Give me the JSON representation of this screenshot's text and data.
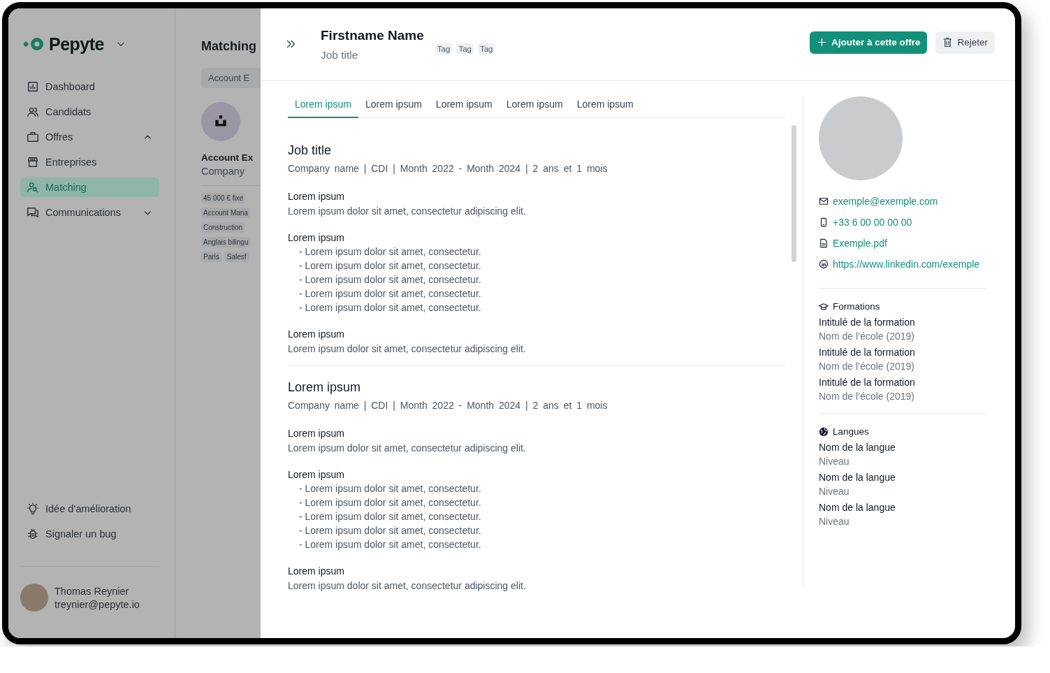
{
  "sidebar": {
    "logo": "Pepyte",
    "nav": [
      {
        "label": "Dashboard",
        "selected": false
      },
      {
        "label": "Candidats",
        "selected": false
      },
      {
        "label": "Offres",
        "selected": false,
        "expanded": true
      },
      {
        "label": "Entreprises",
        "selected": false
      },
      {
        "label": "Matching",
        "selected": true
      },
      {
        "label": "Communications",
        "selected": false,
        "expanded": false
      }
    ],
    "footer": [
      {
        "label": "Idée d’amélioration"
      },
      {
        "label": "Signaler un bug"
      }
    ],
    "user": {
      "name": "Thomas Reynier",
      "email": "treynier@pepyte.io"
    }
  },
  "list_panel": {
    "title": "Matching",
    "filter": "Account E",
    "offer": {
      "title": "Account Ex",
      "company": "Company",
      "tags": [
        [
          "45 000 € fixe"
        ],
        [
          "Account Mana"
        ],
        [
          "Construction"
        ],
        [
          "Anglais bilingu"
        ],
        [
          "Paris",
          "Salesf"
        ]
      ]
    }
  },
  "drawer": {
    "header": {
      "name": "Firstname Name",
      "job_title": "Job title",
      "tags": [
        "Tag",
        "Tag",
        "Tag"
      ],
      "primary_button": "Ajouter à cette offre",
      "secondary_button": "Rejeter"
    },
    "tabs": [
      {
        "label": "Lorem ipsum",
        "selected": true
      },
      {
        "label": "Lorem ipsum",
        "selected": false
      },
      {
        "label": "Lorem ipsum",
        "selected": false
      },
      {
        "label": "Lorem ipsum",
        "selected": false
      },
      {
        "label": "Lorem ipsum",
        "selected": false
      }
    ],
    "experiences": [
      {
        "title": "Job title",
        "meta": "Company name | CDI | Month 2022 - Month 2024 | 2 ans et 1 mois",
        "sections": [
          {
            "kind": "text",
            "heading": "Lorem ipsum",
            "text": "Lorem ipsum dolor sit amet, consectetur adipiscing elit."
          },
          {
            "kind": "list",
            "heading": "Lorem ipsum",
            "items": [
              "- Lorem ipsum dolor sit amet, consectetur.",
              "- Lorem ipsum dolor sit amet, consectetur.",
              "- Lorem ipsum dolor sit amet, consectetur.",
              "- Lorem ipsum dolor sit amet, consectetur.",
              "- Lorem ipsum dolor sit amet, consectetur."
            ]
          },
          {
            "kind": "text",
            "heading": "Lorem ipsum",
            "text": "Lorem ipsum dolor sit amet, consectetur adipiscing elit."
          }
        ]
      },
      {
        "title": "Lorem ipsum",
        "meta": "Company name | CDI | Month 2022 - Month 2024 | 2 ans et 1 mois",
        "sections": [
          {
            "kind": "text",
            "heading": "Lorem ipsum",
            "text": "Lorem ipsum dolor sit amet, consectetur adipiscing elit."
          },
          {
            "kind": "list",
            "heading": "Lorem ipsum",
            "items": [
              "- Lorem ipsum dolor sit amet, consectetur.",
              "- Lorem ipsum dolor sit amet, consectetur.",
              "- Lorem ipsum dolor sit amet, consectetur.",
              "- Lorem ipsum dolor sit amet, consectetur.",
              "- Lorem ipsum dolor sit amet, consectetur."
            ]
          },
          {
            "kind": "text",
            "heading": "Lorem ipsum",
            "text": "Lorem ipsum dolor sit amet, consectetur adipiscing elit."
          }
        ]
      }
    ],
    "contact": [
      {
        "kind": "email",
        "text": "exemple@exemple.com"
      },
      {
        "kind": "phone",
        "text": "+33 6 00 00 00 00"
      },
      {
        "kind": "file",
        "text": "Exemple.pdf"
      },
      {
        "kind": "linkedin",
        "text": "https://www.linkedin.com/exemple"
      }
    ],
    "formations": {
      "title": "Formations",
      "items": [
        {
          "title": "Intitulé de la formation",
          "subtitle": "Nom de l’école (2019)"
        },
        {
          "title": "Intitulé de la formation",
          "subtitle": "Nom de l’école (2019)"
        },
        {
          "title": "Intitulé de la formation",
          "subtitle": "Nom de l’école (2019)"
        }
      ]
    },
    "langues": {
      "title": "Langues",
      "items": [
        {
          "title": "Nom de la langue",
          "subtitle": "Niveau"
        },
        {
          "title": "Nom de la langue",
          "subtitle": "Niveau"
        },
        {
          "title": "Nom de la langue",
          "subtitle": "Niveau"
        }
      ]
    }
  }
}
